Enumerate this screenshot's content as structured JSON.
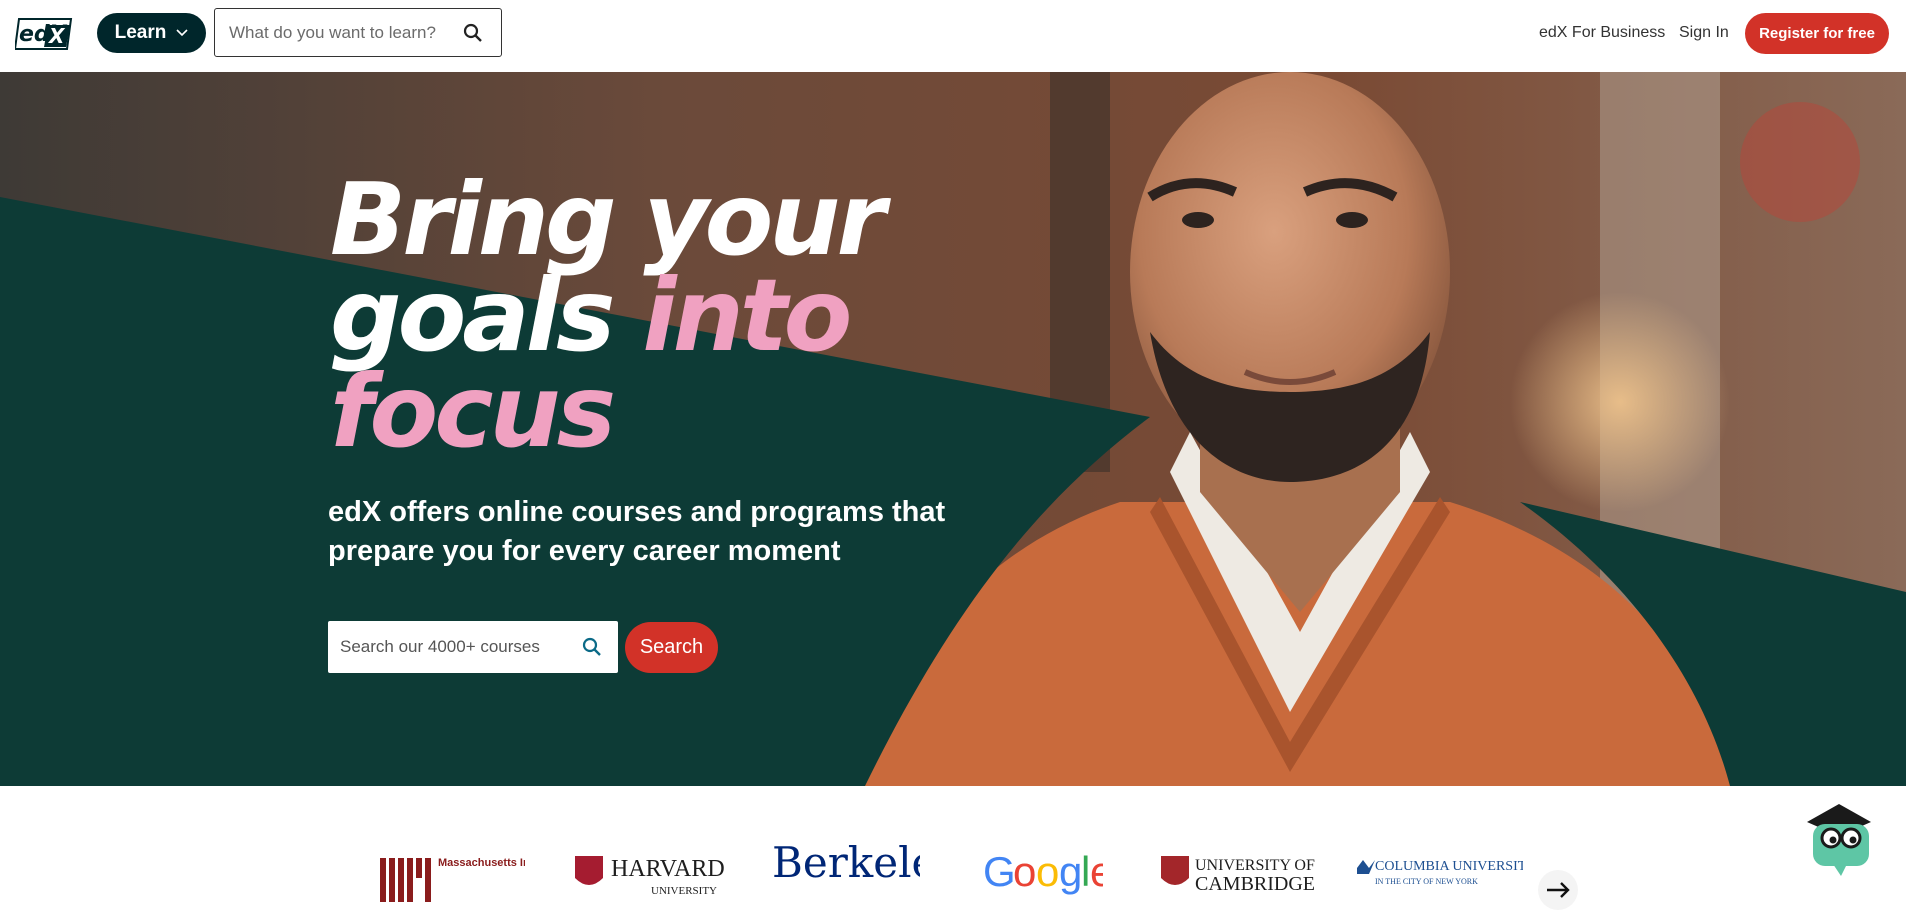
{
  "header": {
    "logo_text": "edX",
    "learn_label": "Learn",
    "search_placeholder": "What do you want to learn?",
    "business_link": "edX For Business",
    "signin_link": "Sign In",
    "register_label": "Register for free"
  },
  "hero": {
    "headline_line1": "Bring your",
    "headline_line2a": "goals ",
    "headline_line2b": "into",
    "headline_line3": "focus",
    "subhead": "edX offers online courses and programs that prepare you for every career moment",
    "search_placeholder": "Search our 4000+ courses",
    "search_button": "Search"
  },
  "partners": {
    "mit": "Massachusetts Institute of Technology",
    "harvard": "HARVARD",
    "harvard_sub": "UNIVERSITY",
    "berkeley": "Berkeley",
    "google": "Google",
    "cambridge_1": "UNIVERSITY OF",
    "cambridge_2": "CAMBRIDGE",
    "columbia_1": "COLUMBIA UNIVERSITY",
    "columbia_2": "IN THE CITY OF NEW YORK"
  },
  "colors": {
    "brand_dark": "#00262b",
    "accent": "#d23228",
    "hero_green": "#0d3b36",
    "pink": "#f0a1c1"
  }
}
